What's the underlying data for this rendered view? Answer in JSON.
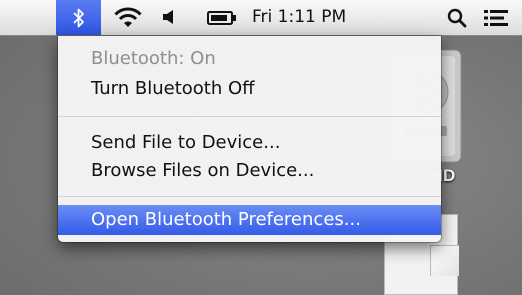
{
  "menubar": {
    "icons": [
      "bluetooth-icon",
      "wifi-icon",
      "volume-icon",
      "battery-icon",
      "spotlight-search-icon",
      "notification-list-icon"
    ],
    "clock": "Fri 1:11 PM"
  },
  "desktop": {
    "drive_label": "Macintosh HD"
  },
  "bluetooth_menu": {
    "status": "Bluetooth: On",
    "toggle": "Turn Bluetooth Off",
    "send_file": "Send File to Device...",
    "browse_files": "Browse Files on Device...",
    "preferences": "Open Bluetooth Preferences..."
  },
  "colors": {
    "highlight": "#345be8",
    "menubar": "#e6e6e6"
  }
}
